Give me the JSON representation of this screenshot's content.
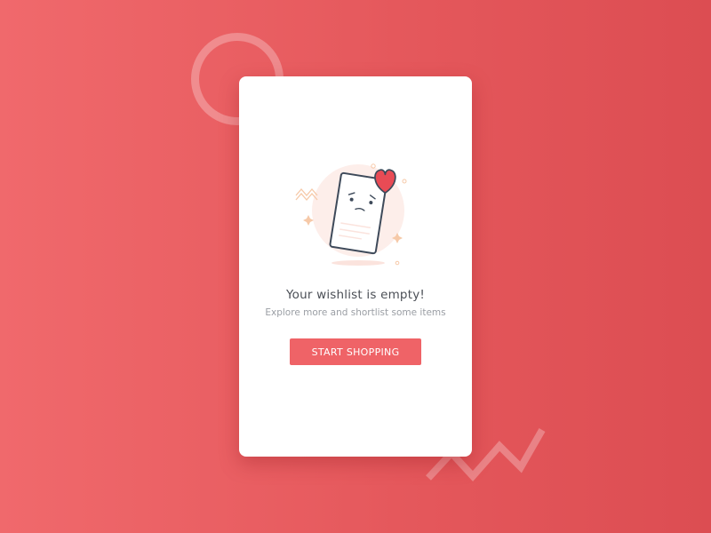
{
  "empty_state": {
    "title": "Your wishlist is empty!",
    "subtitle": "Explore more and shortlist some items",
    "cta_label": "START SHOPPING",
    "illustration_icon": "sad-wishlist-document-heart-icon"
  },
  "colors": {
    "background_start": "#f0696c",
    "background_end": "#dc4d52",
    "card": "#ffffff",
    "accent": "#ef6367",
    "title_text": "#4b4f56",
    "subtitle_text": "#9a9ea4"
  }
}
